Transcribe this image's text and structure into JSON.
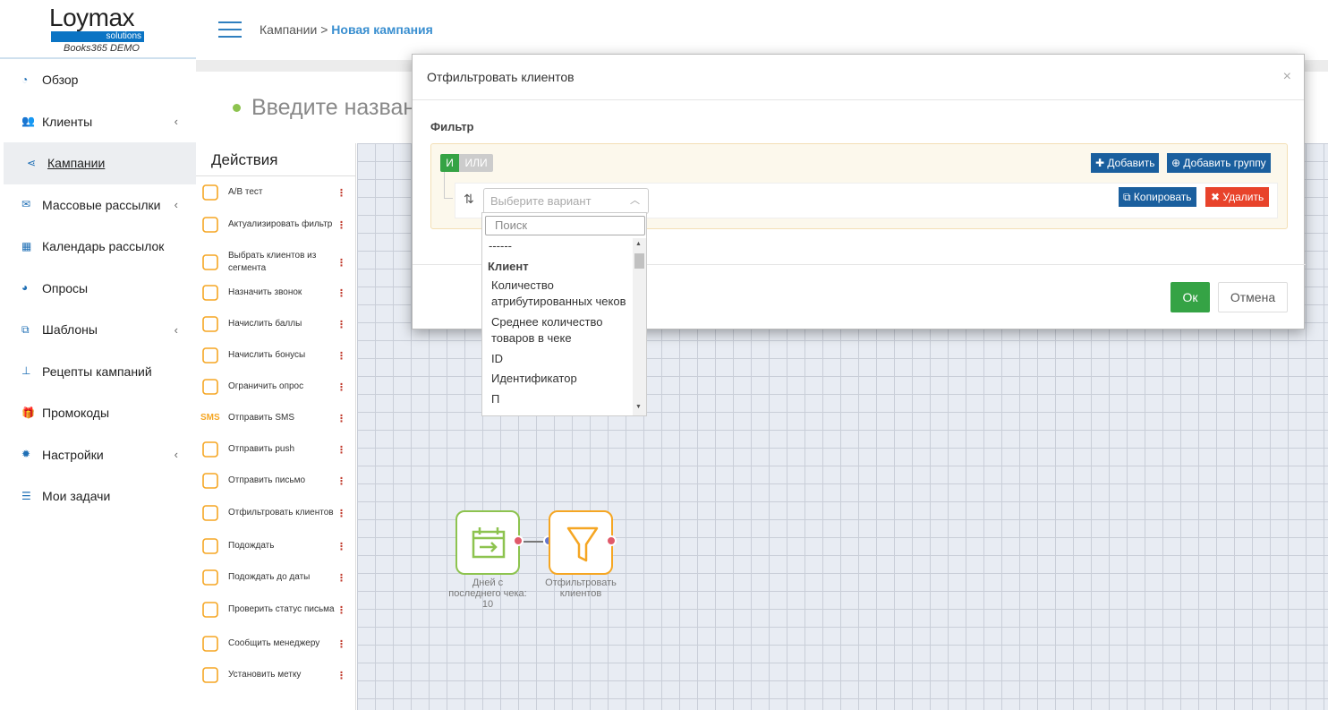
{
  "logo": {
    "name": "Loymax",
    "bar": "solutions",
    "sub": "Books365 DEMO"
  },
  "sidebar": {
    "items": [
      {
        "label": "Обзор",
        "icon": "dashboard-icon",
        "chevron": ""
      },
      {
        "label": "Клиенты",
        "icon": "users-icon",
        "chevron": "‹"
      },
      {
        "label": "Кампании",
        "icon": "share-icon",
        "chevron": ""
      },
      {
        "label": "Массовые рассылки",
        "icon": "envelope-icon",
        "chevron": "‹"
      },
      {
        "label": "Календарь рассылок",
        "icon": "calendar-icon",
        "chevron": ""
      },
      {
        "label": "Опросы",
        "icon": "pie-chart-icon",
        "chevron": ""
      },
      {
        "label": "Шаблоны",
        "icon": "copy-icon",
        "chevron": "‹"
      },
      {
        "label": "Рецепты кампаний",
        "icon": "sitemap-icon",
        "chevron": ""
      },
      {
        "label": "Промокоды",
        "icon": "gift-icon",
        "chevron": ""
      },
      {
        "label": "Настройки",
        "icon": "gear-icon",
        "chevron": "‹"
      },
      {
        "label": "Мои задачи",
        "icon": "tasks-icon",
        "chevron": ""
      }
    ]
  },
  "header": {
    "crumb1": "Кампании",
    "separator": ">",
    "crumb2": "Новая кампания"
  },
  "campaign": {
    "name_placeholder": "Введите назван"
  },
  "actions": {
    "title": "Действия",
    "items": [
      "A/B тест",
      "Актуализировать фильтр",
      "Выбрать клиентов из сегмента",
      "Назначить звонок",
      "Начислить баллы",
      "Начислить бонусы",
      "Ограничить опрос",
      "Отправить SMS",
      "Отправить push",
      "Отправить письмо",
      "Отфильтровать клиентов",
      "Подождать",
      "Подождать до даты",
      "Проверить статус письма",
      "Сообщить менеджеру",
      "Установить метку"
    ],
    "menu_glyph": "⋮",
    "sms_icon_text": "SMS"
  },
  "canvas": {
    "node1": {
      "label": "Дней с последнего чека: 10"
    },
    "node2": {
      "label": "Отфильтровать клиентов"
    }
  },
  "modal": {
    "title": "Отфильтровать клиентов",
    "close": "×",
    "filter_label": "Фильтр",
    "and": "И",
    "or": "ИЛИ",
    "add": "Добавить",
    "add_group": "Добавить группу",
    "copy": "Копировать",
    "delete": "Удалить",
    "select_placeholder": "Выберите вариант",
    "ok": "Ок",
    "cancel": "Отмена"
  },
  "dropdown": {
    "search_placeholder": "Поиск",
    "first": "------",
    "group": "Клиент",
    "options": [
      "Количество атрибутированных чеков",
      "Среднее количество товаров в чеке",
      "ID",
      "Идентификатор",
      "П"
    ]
  },
  "colors": {
    "accent": "#3a8fd0",
    "green": "#35a345",
    "orange": "#f5a623",
    "red": "#e8432b",
    "blue": "#1a5f9e"
  }
}
